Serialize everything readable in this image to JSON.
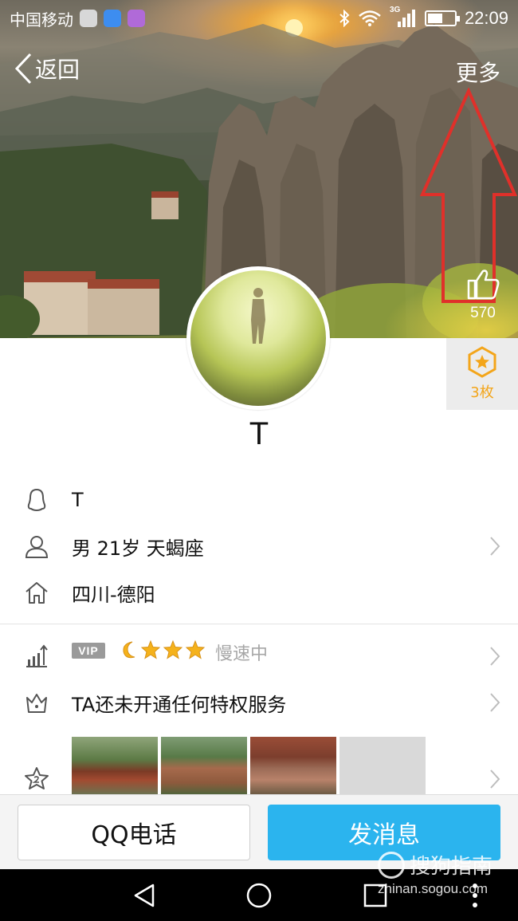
{
  "status_bar": {
    "carrier": "中国移动",
    "network": "3G",
    "time": "22:09",
    "battery_level": 0.62
  },
  "nav": {
    "back_label": "返回",
    "more_label": "更多"
  },
  "profile": {
    "likes": "570",
    "medals": "3枚",
    "nickname": "T"
  },
  "info": {
    "qq_name": "T",
    "basic": "男  21岁  天蝎座",
    "location": "四川-德阳"
  },
  "vip": {
    "tag": "VIP",
    "status": "慢速中",
    "level_icons": [
      "moon-icon",
      "star-icon",
      "star-icon",
      "star-icon"
    ]
  },
  "privilege": {
    "text": "TA还未开通任何特权服务"
  },
  "actions": {
    "call_label": "QQ电话",
    "message_label": "发消息"
  },
  "watermark": {
    "brand": "搜狗指南",
    "url": "zhinan.sogou.com"
  },
  "colors": {
    "accent": "#2bb4ee",
    "medal": "#f3a51a",
    "annotation": "#e0302a"
  }
}
